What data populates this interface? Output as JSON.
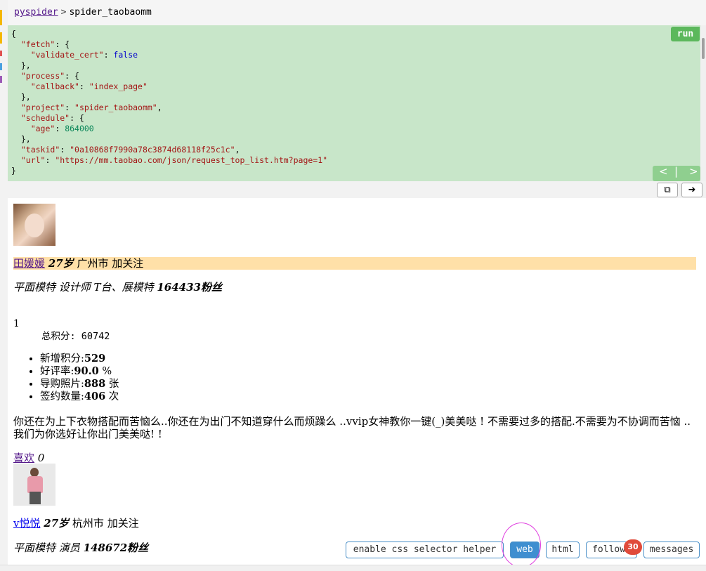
{
  "breadcrumb": {
    "root": "pyspider",
    "separator": ">",
    "project": "spider_taobaomm"
  },
  "task": {
    "run_label": "run",
    "lines": [
      [
        {
          "t": "{",
          "c": ""
        }
      ],
      [
        {
          "t": "  ",
          "c": ""
        },
        {
          "t": "\"fetch\"",
          "c": "k"
        },
        {
          "t": ": {",
          "c": ""
        }
      ],
      [
        {
          "t": "    ",
          "c": ""
        },
        {
          "t": "\"validate_cert\"",
          "c": "k"
        },
        {
          "t": ": ",
          "c": ""
        },
        {
          "t": "false",
          "c": "b"
        }
      ],
      [
        {
          "t": "  },",
          "c": ""
        }
      ],
      [
        {
          "t": "  ",
          "c": ""
        },
        {
          "t": "\"process\"",
          "c": "k"
        },
        {
          "t": ": {",
          "c": ""
        }
      ],
      [
        {
          "t": "    ",
          "c": ""
        },
        {
          "t": "\"callback\"",
          "c": "k"
        },
        {
          "t": ": ",
          "c": ""
        },
        {
          "t": "\"index_page\"",
          "c": "s"
        }
      ],
      [
        {
          "t": "  },",
          "c": ""
        }
      ],
      [
        {
          "t": "  ",
          "c": ""
        },
        {
          "t": "\"project\"",
          "c": "k"
        },
        {
          "t": ": ",
          "c": ""
        },
        {
          "t": "\"spider_taobaomm\"",
          "c": "s"
        },
        {
          "t": ",",
          "c": ""
        }
      ],
      [
        {
          "t": "  ",
          "c": ""
        },
        {
          "t": "\"schedule\"",
          "c": "k"
        },
        {
          "t": ": {",
          "c": ""
        }
      ],
      [
        {
          "t": "    ",
          "c": ""
        },
        {
          "t": "\"age\"",
          "c": "k"
        },
        {
          "t": ": ",
          "c": ""
        },
        {
          "t": "864000",
          "c": "n"
        }
      ],
      [
        {
          "t": "  },",
          "c": ""
        }
      ],
      [
        {
          "t": "  ",
          "c": ""
        },
        {
          "t": "\"taskid\"",
          "c": "k"
        },
        {
          "t": ": ",
          "c": ""
        },
        {
          "t": "\"0a10868f7990a78c3874d68118f25c1c\"",
          "c": "s"
        },
        {
          "t": ",",
          "c": ""
        }
      ],
      [
        {
          "t": "  ",
          "c": ""
        },
        {
          "t": "\"url\"",
          "c": "k"
        },
        {
          "t": ": ",
          "c": ""
        },
        {
          "t": "\"https://mm.taobao.com/json/request_top_list.htm?page=1\"",
          "c": "s"
        }
      ],
      [
        {
          "t": "}",
          "c": ""
        }
      ]
    ],
    "pager": {
      "prev": "<",
      "divider": "|",
      "next": ">"
    }
  },
  "toolbar": {
    "copy_icon": "copy-icon",
    "goto_icon": "arrow-right-icon",
    "copy_glyph": "⧉",
    "goto_glyph": "➜"
  },
  "profiles": [
    {
      "name": "田媛媛",
      "age": "27岁",
      "city": "广州市",
      "follow": "加关注",
      "tags": "平面模特 设计师 T台、展模特",
      "fans": "164433粉丝",
      "rank": "1",
      "total_label": "总积分:",
      "total_value": "60742",
      "stats": [
        {
          "label": "新增积分:",
          "value": "529",
          "unit": ""
        },
        {
          "label": "好评率:",
          "value": "90.0",
          "unit": "%"
        },
        {
          "label": "导购照片:",
          "value": "888",
          "unit": "张"
        },
        {
          "label": "签约数量:",
          "value": "406",
          "unit": "次"
        }
      ],
      "bio": "你还在为上下衣物搭配而苦恼么..你还在为出门不知道穿什么而烦躁么 ..vvip女神教你一键(_)美美哒 !  不需要过多的搭配.不需要为不协调而苦恼 ..我们为你选好让你出门美美哒! !",
      "like_label": "喜欢",
      "like_count": "0"
    },
    {
      "name": "v悦悦",
      "age": "27岁",
      "city": "杭州市",
      "follow": "加关注",
      "tags": "平面模特 演员",
      "fans": "148672粉丝"
    }
  ],
  "panel_buttons": {
    "css_helper": "enable css selector helper",
    "web": "web",
    "html": "html",
    "follows": "follows",
    "follows_count": "30",
    "messages": "messages"
  },
  "colors": {
    "task_bg": "#c8e6c9",
    "run_bg": "#5cb85c",
    "highlight": "#ffe0a8",
    "accent": "#3e8ed0",
    "badge": "#e04b3b"
  }
}
